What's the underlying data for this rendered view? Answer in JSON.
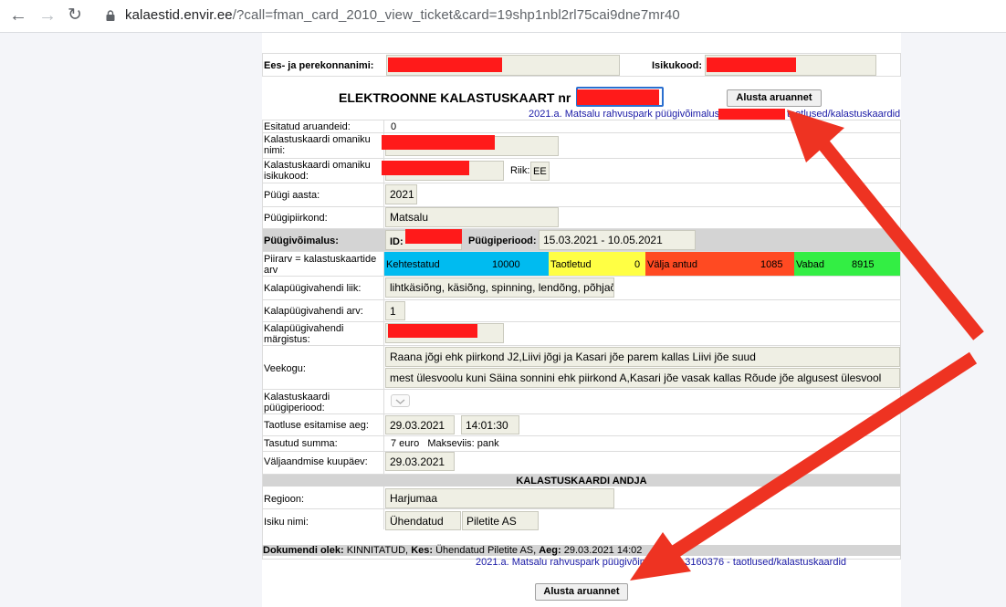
{
  "browser": {
    "url_host": "kalaestid.envir.ee",
    "url_rest": "/?call=fman_card_2010_view_ticket&card=19shp1nbl2rl75cai9dne7mr40"
  },
  "header": {
    "name_label": "Ees- ja perekonnanimi:",
    "idcode_label": "Isikukood:",
    "title": "ELEKTROONNE KALASTUSKAART nr",
    "report_button": "Alusta aruannet",
    "link_top_a": "2021.a. Matsalu rahvuspark püügivõimalus",
    "link_top_b": "taotlused/kalastuskaardid"
  },
  "rows": {
    "reports_label": "Esitatud aruandeid:",
    "reports_value": "0",
    "owner_name_label_1": "Kalastuskaardi omaniku",
    "owner_name_label_2": "nimi:",
    "owner_id_label_1": "Kalastuskaardi omaniku",
    "owner_id_label_2": "isikukood:",
    "country_label": "Riik:",
    "country_value": "EE",
    "year_label": "Püügi aasta:",
    "year_value": "2021",
    "region_label": "Püügipiirkond:",
    "region_value": "Matsalu",
    "opportunity_label": "Püügivõimalus:",
    "id_label": "ID:",
    "period_label": "Püügiperiood:",
    "period_value": "15.03.2021 - 10.05.2021",
    "limit_label_1": "Piirarv = kalastuskaartide",
    "limit_label_2": "arv",
    "gear_type_label": "Kalapüügivahendi liik:",
    "gear_type_value": "lihtkäsiõng, käsiõng, spinning, lendõng, põhjaõn",
    "gear_count_label": "Kalapüügivahendi arv:",
    "gear_count_value": "1",
    "gear_mark_label_1": "Kalapüügivahendi",
    "gear_mark_label_2": "märgistus:",
    "water_label": "Veekogu:",
    "water_value_1": "Raana jõgi ehk piirkond J2,Liivi jõgi ja Kasari jõe parem kallas Liivi jõe suud",
    "water_value_2": "mest ülesvoolu kuni Säina sonnini ehk piirkond A,Kasari jõe vasak kallas Rõude jõe algusest ülesvool",
    "card_period_label_1": "Kalastuskaardi",
    "card_period_label_2": "püügiperiood:",
    "submit_label": "Taotluse esitamise aeg:",
    "submit_date": "29.03.2021",
    "submit_time": "14:01:30",
    "paid_label": "Tasutud summa:",
    "paid_value": "7 euro   Makseviis: pank",
    "issue_label": "Väljaandmise kuupäev:",
    "issue_value": "29.03.2021",
    "issuer_section": "KALASTUSKAARDI ANDJA",
    "issuer_region_label": "Regioon:",
    "issuer_region_value": "Harjumaa",
    "issuer_name_label": "Isiku nimi:",
    "issuer_name_a": "Ühendatud",
    "issuer_name_b": "Piletite AS"
  },
  "status": {
    "valid_label": "Kehtestatud",
    "valid_value": "10000",
    "applied_label": "Taotletud",
    "applied_value": "0",
    "issued_label": "Välja antud",
    "issued_value": "1085",
    "free_label": "Vabad",
    "free_value": "8915",
    "colors": {
      "valid": "#00bbf0",
      "applied": "#ffff44",
      "issued": "#ff4a22",
      "free": "#33ee44"
    }
  },
  "footer": {
    "doc_state_label": "Dokumendi olek:",
    "doc_state_value": "KINNITATUD,",
    "by_label": "Kes:",
    "by_value": "Ühendatud Piletite AS,",
    "time_label": "Aeg:",
    "time_value": "29.03.2021 14:02",
    "link_bottom": "2021.a. Matsalu rahvuspark püügivõimalus ID: 3160376 - taotlused/kalastuskaardid",
    "report_button": "Alusta aruannet"
  },
  "annotation": {
    "arrow_color": "#ee3322"
  }
}
